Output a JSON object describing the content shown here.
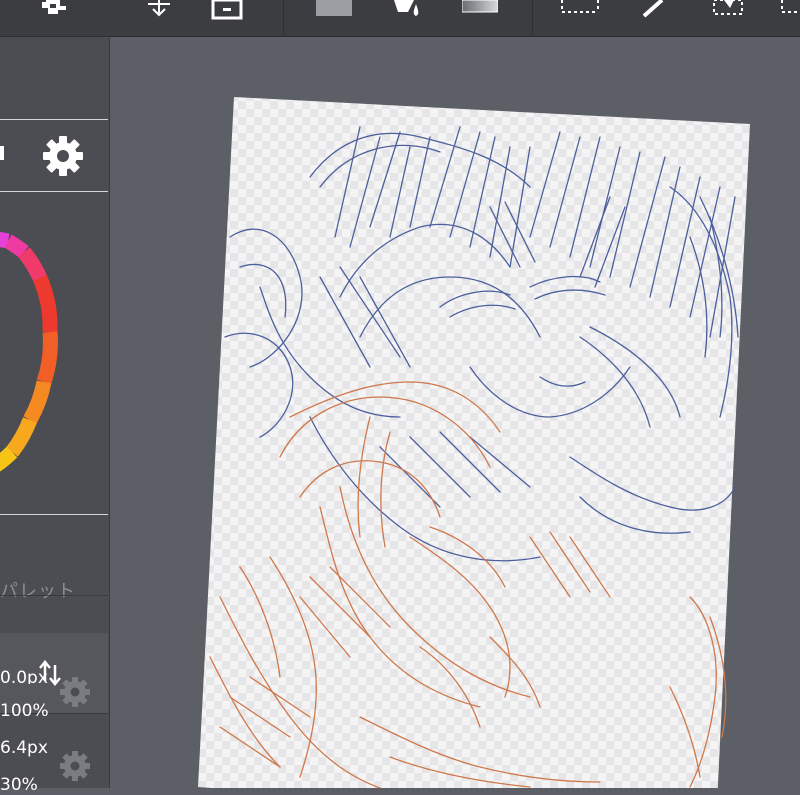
{
  "toolbar": {
    "icons": [
      "transform-tool-icon",
      "move-tool-icon",
      "layer-tool-icon",
      "fill-color-icon",
      "bucket-tool-icon",
      "gradient-tool-icon",
      "rect-select-icon",
      "pen-tool-icon",
      "select-transform-icon",
      "lasso-select-icon"
    ]
  },
  "panel": {
    "settings_icon": "gear-icon",
    "palette_label": "パレット",
    "swap_icon": "up-down-arrows-icon"
  },
  "brush_properties": [
    {
      "value": "0.0px",
      "gear": true
    },
    {
      "value": "100%",
      "gear": false
    },
    {
      "value": "6.4px",
      "gear": true
    },
    {
      "value": "30%",
      "gear": false
    }
  ],
  "colors": {
    "toolbar_bg": "#3c3d40",
    "panel_bg": "#4c4d52",
    "canvas_bg": "#5c5f66",
    "sketch_blue": "#4c5f9c",
    "sketch_orange": "#d0784a"
  }
}
